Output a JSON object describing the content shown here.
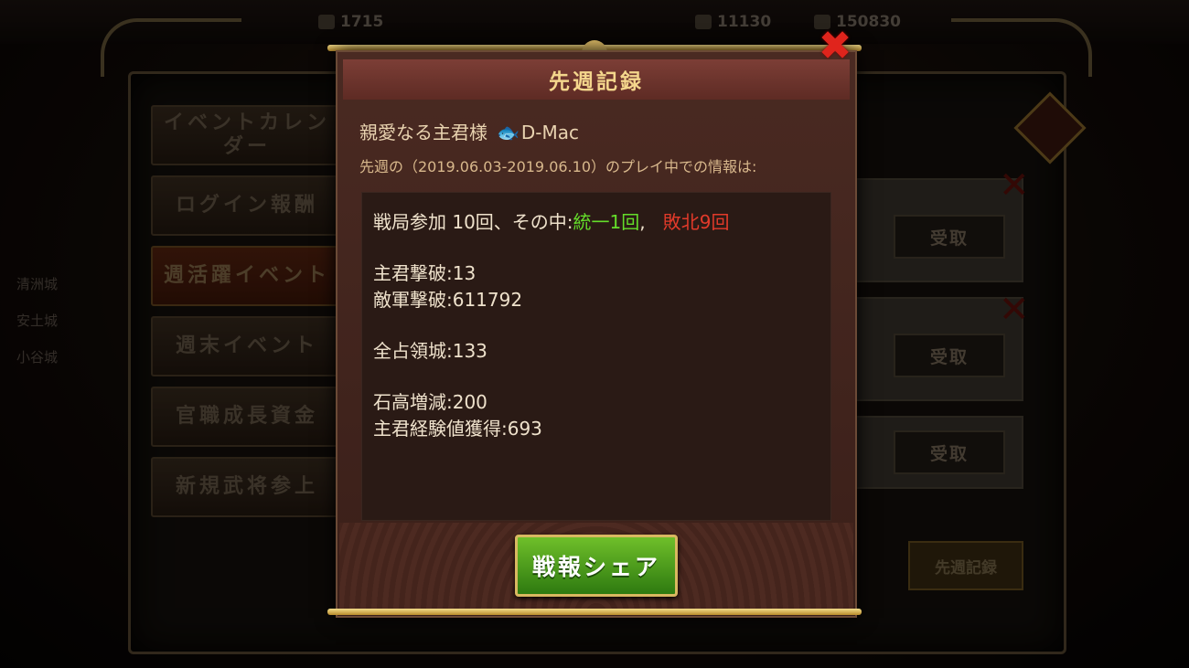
{
  "background": {
    "resources": [
      "1715",
      "11130",
      "150830"
    ],
    "left_tabs": [
      {
        "label": "イベントカレンダー",
        "active": false
      },
      {
        "label": "ログイン報酬",
        "active": false
      },
      {
        "label": "週活躍イベント",
        "active": true
      },
      {
        "label": "週末イベント",
        "active": false
      },
      {
        "label": "官職成長資金",
        "active": false
      },
      {
        "label": "新規武将参上",
        "active": false
      }
    ],
    "left_info": [
      "清洲城",
      "安土城",
      "小谷城"
    ],
    "receive_label": "受取",
    "weekly_record_label": "先週記録"
  },
  "dialog": {
    "title": "先週記録",
    "greeting": "親愛なる主君様",
    "player_name": "D-Mac",
    "period_text": "先週の（2019.06.03-2019.06.10）のプレイ中での情報は:",
    "stats": {
      "battle_prefix": "戦局参加 10回、その中:",
      "unify": "統一1回",
      "comma": ",",
      "defeat": "敗北9回",
      "lord_kills": "主君撃破:13",
      "enemy_kills": "敵軍撃破:611792",
      "castles": "全占領城:133",
      "stone": "石高増減:200",
      "exp": "主君経験値獲得:693"
    },
    "share_button": "戦報シェア"
  },
  "colors": {
    "accent_gold": "#f4d68c",
    "win_green": "#64dd2a",
    "loss_red": "#e23a2a",
    "close_red": "#e0241c"
  }
}
